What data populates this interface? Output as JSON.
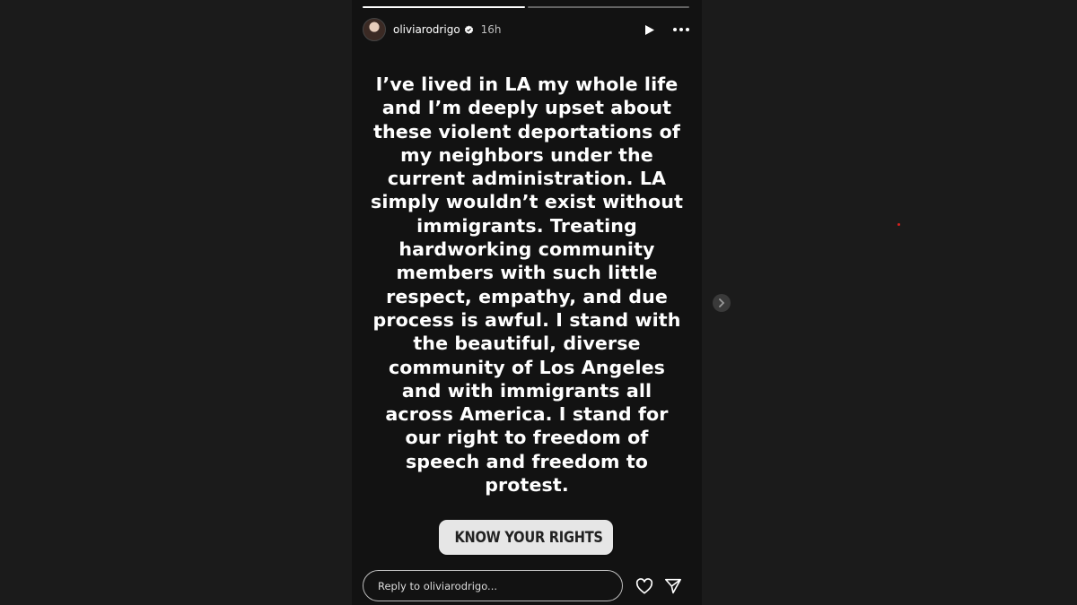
{
  "story": {
    "progress": [
      {
        "fill_percent": 100
      },
      {
        "fill_percent": 0
      }
    ],
    "username": "oliviarodrigo",
    "time_ago": "16h",
    "verified": true,
    "icons": {
      "avatar": "profile-avatar",
      "verified": "verified-badge-icon",
      "play": "play-icon",
      "more": "more-horizontal-icon",
      "link": "link-icon",
      "heart": "heart-icon",
      "send": "send-icon",
      "next": "chevron-right-icon"
    },
    "message": "I’ve lived in LA my whole life\nand I’m deeply upset about\nthese violent deportations of\nmy neighbors under the\ncurrent administration. LA\nsimply wouldn’t exist without\nimmigrants. Treating\nhardworking community\nmembers with such little\nrespect, empathy, and due\nprocess is awful. I stand with\nthe beautiful, diverse\ncommunity of Los Angeles\nand with immigrants all\nacross America. I stand for\nour right to freedom of\nspeech and freedom to\nprotest.",
    "link_sticker": {
      "label": "KNOW YOUR RIGHTS"
    },
    "reply": {
      "placeholder": "Reply to oliviarodrigo..."
    }
  },
  "colors": {
    "page_bg": "#1b1b1b",
    "story_bg": "#121212",
    "sticker_bg": "#e6e6e6",
    "link_gradient": [
      "#f9a23a",
      "#e1306c",
      "#8a3ab9"
    ]
  }
}
